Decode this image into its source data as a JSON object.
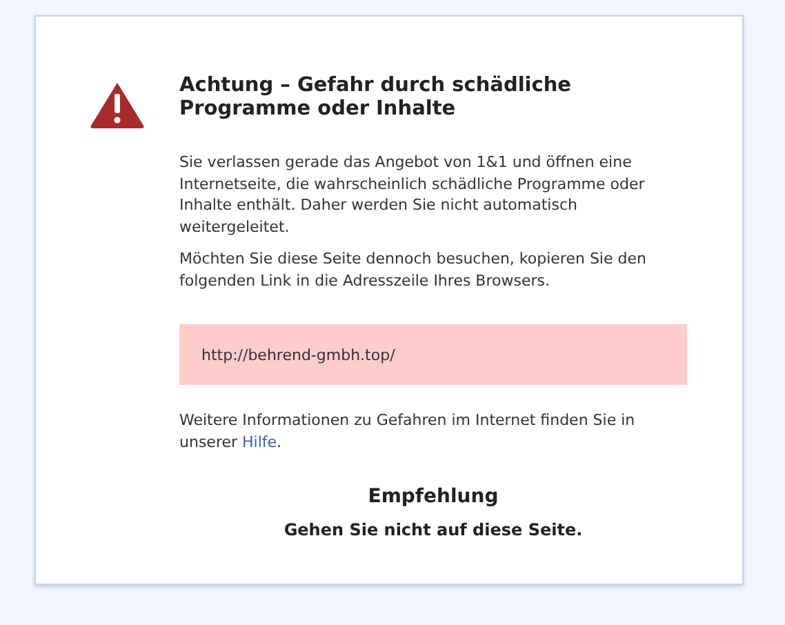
{
  "warning": {
    "title": "Achtung – Gefahr durch schädliche Programme oder Inhalte",
    "paragraphs": [
      "Sie verlassen gerade das Angebot von 1&1 und öffnen eine Internetseite, die wahrscheinlich schädliche Programme oder Inhalte enthält. Daher werden Sie nicht automatisch weitergeleitet.",
      "Möchten Sie diese Seite dennoch besuchen, kopieren Sie den folgenden Link in die Adresszeile Ihres Browsers."
    ],
    "url": "http://behrend-gmbh.top/",
    "info": {
      "text": "Weitere Informationen zu Gefahren im Internet finden Sie in unserer",
      "link": "Hilfe",
      "after": "."
    },
    "recommendation": {
      "heading": "Empfehlung",
      "text": "Gehen Sie nicht auf diese Seite."
    }
  }
}
